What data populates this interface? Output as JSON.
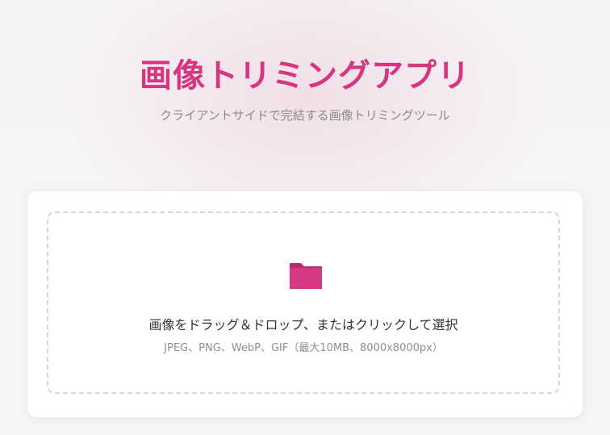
{
  "header": {
    "title": "画像トリミングアプリ",
    "subtitle": "クライアントサイドで完結する画像トリミングツール"
  },
  "upload": {
    "icon": "folder-icon",
    "prompt": "画像をドラッグ＆ドロップ、またはクリックして選択",
    "formats": "JPEG、PNG、WebP、GIF（最大10MB、8000x8000px）"
  },
  "colors": {
    "accent": "#d6357f",
    "background": "#f6f3f6",
    "card": "#ffffff",
    "dropzone_border": "#d6d6d6"
  }
}
